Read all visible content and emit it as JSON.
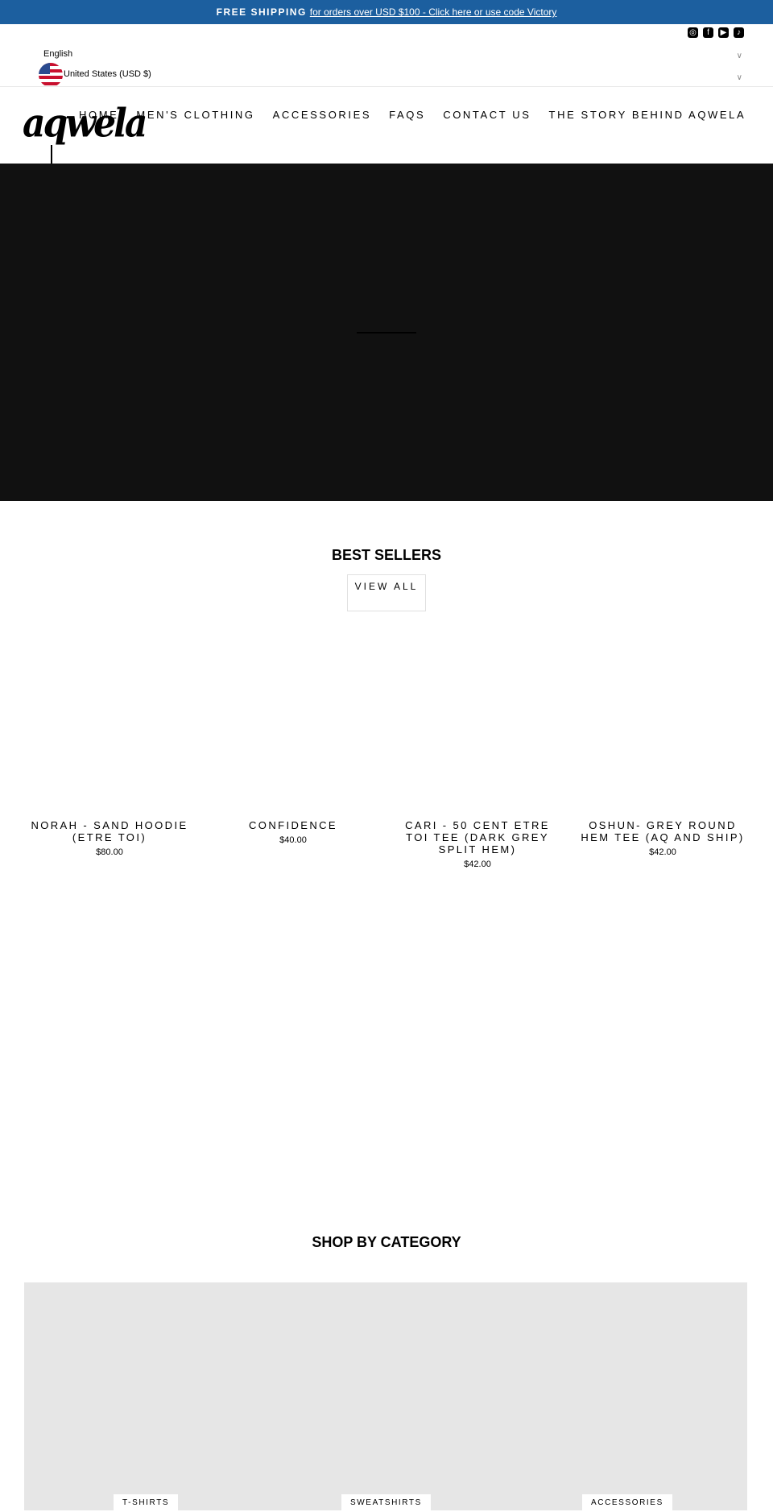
{
  "banner": {
    "bold": "FREE SHIPPING",
    "link": "for orders over USD $100 - Click here or use code Victory",
    "color": "#1c5f9f"
  },
  "social": [
    {
      "icon": "instagram-icon",
      "glyph": "◎"
    },
    {
      "icon": "facebook-icon",
      "glyph": "f"
    },
    {
      "icon": "youtube-icon",
      "glyph": "▶"
    },
    {
      "icon": "tiktok-icon",
      "glyph": "♪"
    }
  ],
  "locale": {
    "language": "English",
    "country": "United States (USD $)"
  },
  "logo": "aqwela",
  "nav": [
    "HOME",
    "MEN'S CLOTHING",
    "ACCESSORIES",
    "FAQS",
    "CONTACT US",
    "THE STORY BEHIND AQWELA"
  ],
  "best_sellers": {
    "title": "BEST SELLERS",
    "view_all": "VIEW ALL",
    "products": [
      {
        "title": "NORAH - SAND HOODIE (ETRE TOI)",
        "price": "$80.00"
      },
      {
        "title": "CONFIDENCE",
        "price": "$40.00"
      },
      {
        "title": "CARI - 50 CENT ETRE TOI TEE (DARK GREY SPLIT HEM)",
        "price": "$42.00"
      },
      {
        "title": "OSHUN- GREY ROUND HEM TEE (AQ AND SHIP)",
        "price": "$42.00"
      }
    ]
  },
  "categories": {
    "title": "SHOP BY CATEGORY",
    "items": [
      "T-SHIRTS",
      "SWEATSHIRTS",
      "ACCESSORIES"
    ]
  }
}
